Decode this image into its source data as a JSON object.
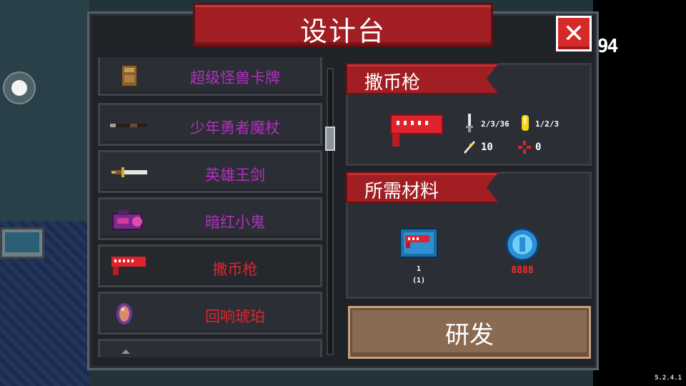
{
  "window": {
    "title": "设计台",
    "close_label": "✕"
  },
  "hud": {
    "counter": "94",
    "version": "5.2.4.1"
  },
  "list": {
    "items": [
      {
        "label": "超级怪兽卡牌",
        "color": "#b12fc0",
        "icon": "card-icon"
      },
      {
        "label": "少年勇者魔杖",
        "color": "#b12fc0",
        "icon": "staff-icon"
      },
      {
        "label": "英雄王剑",
        "color": "#b12fc0",
        "icon": "sword-icon"
      },
      {
        "label": "暗红小鬼",
        "color": "#b12fc0",
        "icon": "imp-icon"
      },
      {
        "label": "撒币枪",
        "color": "#e0242e",
        "icon": "coin-gun-icon",
        "selected": true
      },
      {
        "label": "回响琥珀",
        "color": "#e0242e",
        "icon": "amber-icon"
      }
    ]
  },
  "detail": {
    "name": "撒币枪",
    "stats": {
      "damage": "2/3/36",
      "energy": "1/2/3",
      "crit": "10",
      "spread": "0"
    }
  },
  "materials": {
    "heading": "所需材料",
    "items": [
      {
        "icon": "blueprint-icon",
        "count_top": "1",
        "count_bottom": "(1)",
        "color": "#ffffff"
      },
      {
        "icon": "gem-icon",
        "count_top": "8888",
        "color": "#ff2d2d"
      }
    ]
  },
  "actions": {
    "research_label": "研发"
  },
  "colors": {
    "accent": "#a11e23",
    "panel": "#1f2226",
    "button": "#8a6a52"
  }
}
